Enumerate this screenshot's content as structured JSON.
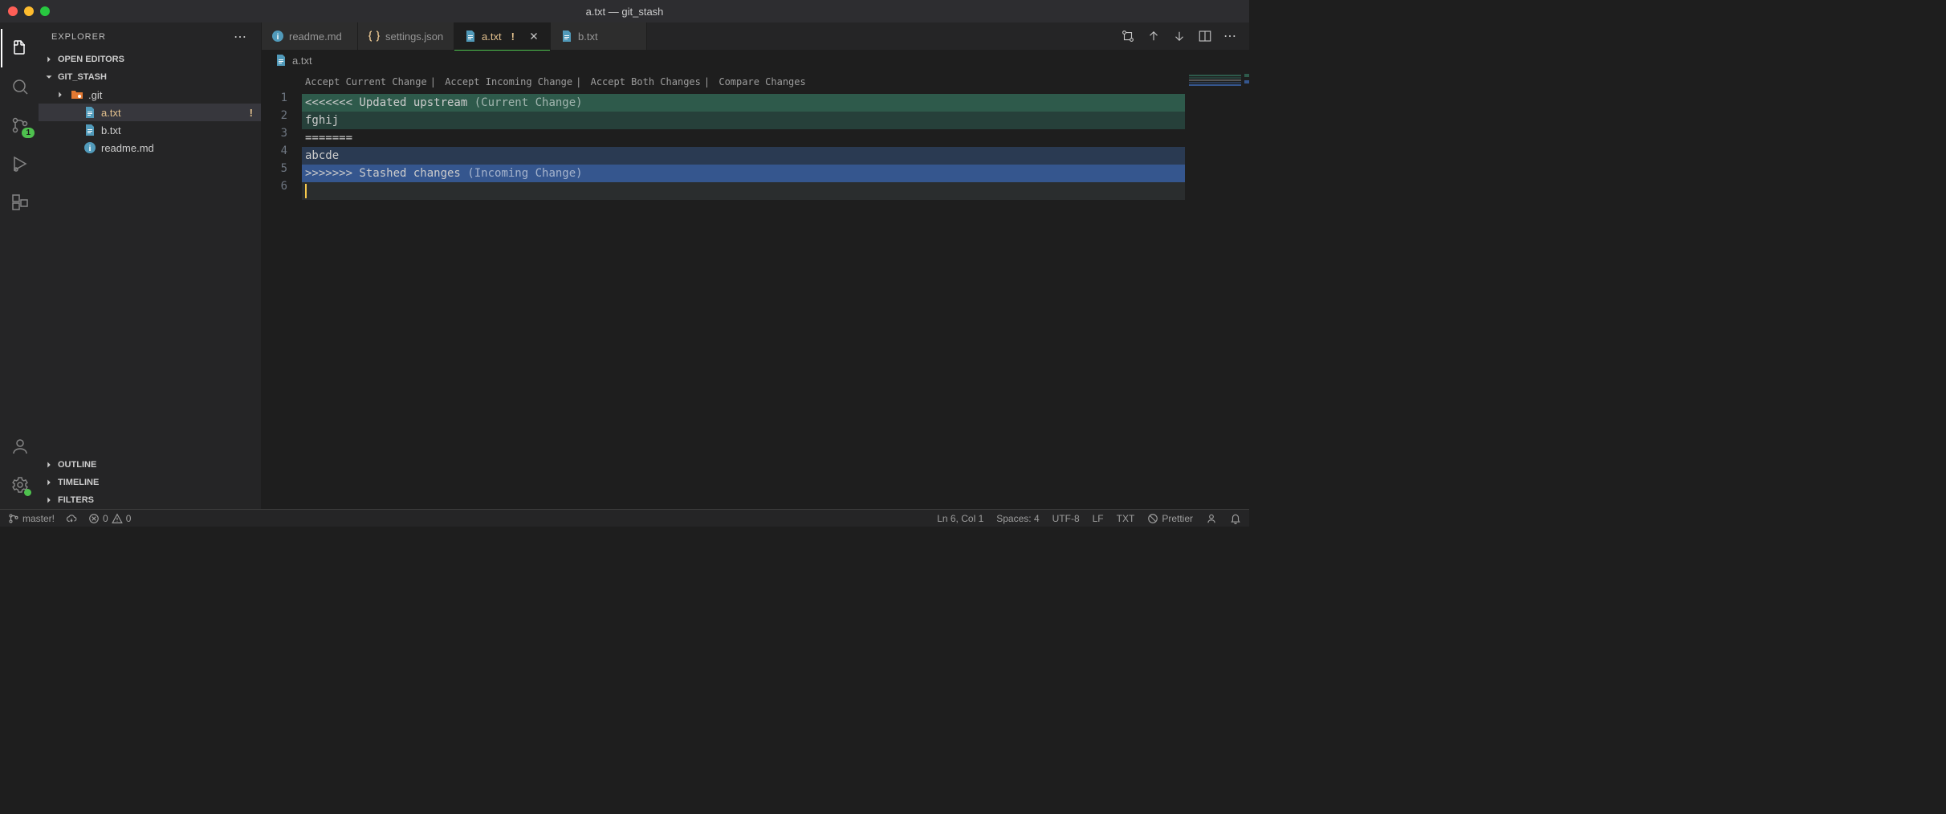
{
  "window": {
    "title": "a.txt — git_stash"
  },
  "explorer": {
    "title": "EXPLORER",
    "sections": {
      "open_editors": "OPEN EDITORS",
      "folder_name": "GIT_STASH",
      "outline": "OUTLINE",
      "timeline": "TIMELINE",
      "filters": "FILTERS"
    },
    "tree": [
      {
        "name": ".git",
        "type": "folder",
        "depth": 1,
        "modified": false
      },
      {
        "name": "a.txt",
        "type": "file",
        "icon": "file-blue",
        "depth": 2,
        "selected": true,
        "modified": true
      },
      {
        "name": "b.txt",
        "type": "file",
        "icon": "file-blue",
        "depth": 2,
        "modified": false
      },
      {
        "name": "readme.md",
        "type": "file",
        "icon": "info-blue",
        "depth": 2,
        "modified": false
      }
    ]
  },
  "activity": {
    "scm_badge": "1"
  },
  "tabs": [
    {
      "label": "readme.md",
      "icon": "info-blue",
      "active": false,
      "modified": false
    },
    {
      "label": "settings.json",
      "icon": "braces-yellow",
      "active": false,
      "modified": false
    },
    {
      "label": "a.txt",
      "icon": "file-blue",
      "active": true,
      "modified": true
    },
    {
      "label": "b.txt",
      "icon": "file-blue",
      "active": false,
      "modified": false
    }
  ],
  "breadcrumb": {
    "file": "a.txt"
  },
  "codelens": {
    "accept_current": "Accept Current Change",
    "accept_incoming": "Accept Incoming Change",
    "accept_both": "Accept Both Changes",
    "compare": "Compare Changes"
  },
  "editor": {
    "lines": [
      {
        "n": 1,
        "kind": "current-head",
        "text": "<<<<<<< Updated upstream",
        "annot": " (Current Change)"
      },
      {
        "n": 2,
        "kind": "current-body",
        "text": "fghij",
        "annot": ""
      },
      {
        "n": 3,
        "kind": "sep-line",
        "text": "=======",
        "annot": ""
      },
      {
        "n": 4,
        "kind": "incoming-body",
        "text": "abcde",
        "annot": ""
      },
      {
        "n": 5,
        "kind": "incoming-head",
        "text": ">>>>>>> Stashed changes",
        "annot": " (Incoming Change)"
      },
      {
        "n": 6,
        "kind": "cursor-line",
        "text": "",
        "annot": ""
      }
    ]
  },
  "statusbar": {
    "branch": "master!",
    "errors": "0",
    "warnings": "0",
    "cursor": "Ln 6, Col 1",
    "spaces": "Spaces: 4",
    "encoding": "UTF-8",
    "eol": "LF",
    "lang": "TXT",
    "prettier": "Prettier"
  }
}
